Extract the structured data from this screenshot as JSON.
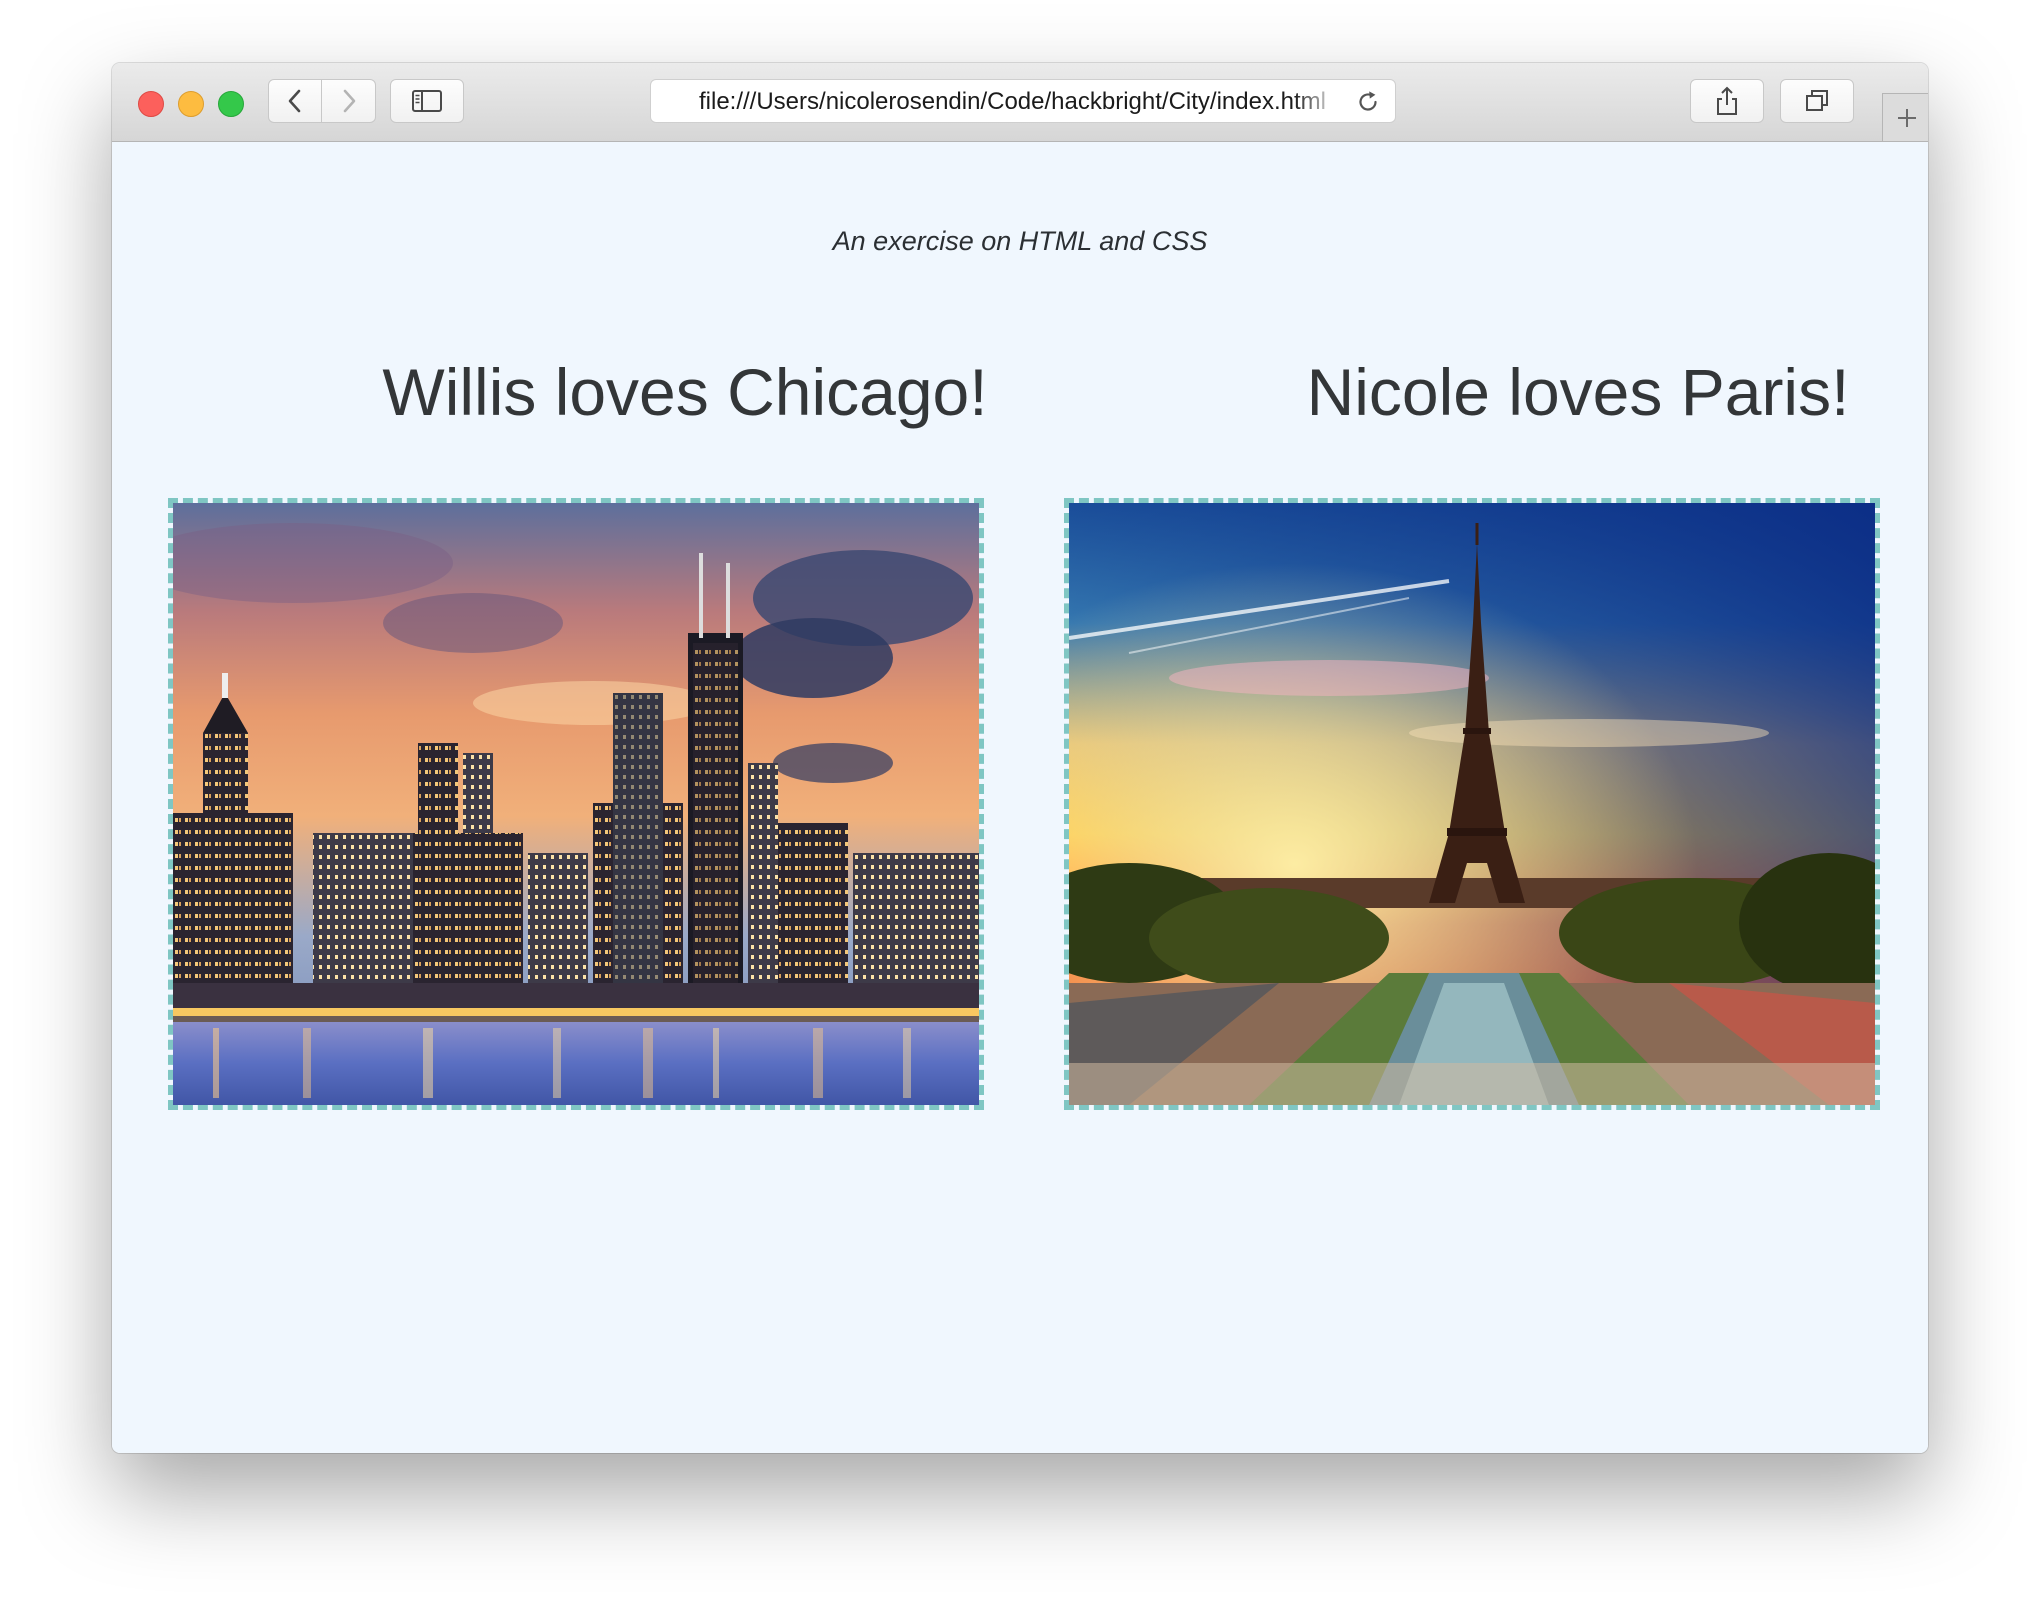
{
  "browser": {
    "url": "file:///Users/nicolerosendin/Code/hackbright/City/index.html",
    "icons": {
      "back": "chevron-left-icon",
      "forward": "chevron-right-icon",
      "sidebar": "sidebar-icon",
      "reload": "reload-icon",
      "share": "share-icon",
      "tabs": "tabs-icon",
      "new_tab": "plus-icon"
    },
    "traffic_colors": {
      "close": "#fc605c",
      "minimize": "#fdbc40",
      "zoom": "#34c84a"
    }
  },
  "page": {
    "tagline": "An exercise on HTML and CSS",
    "background": "#f0f7fe",
    "frame_border_color": "#7fc6c3",
    "cities": [
      {
        "title": "Willis loves Chicago!"
      },
      {
        "title": "Nicole loves Paris!"
      }
    ]
  }
}
